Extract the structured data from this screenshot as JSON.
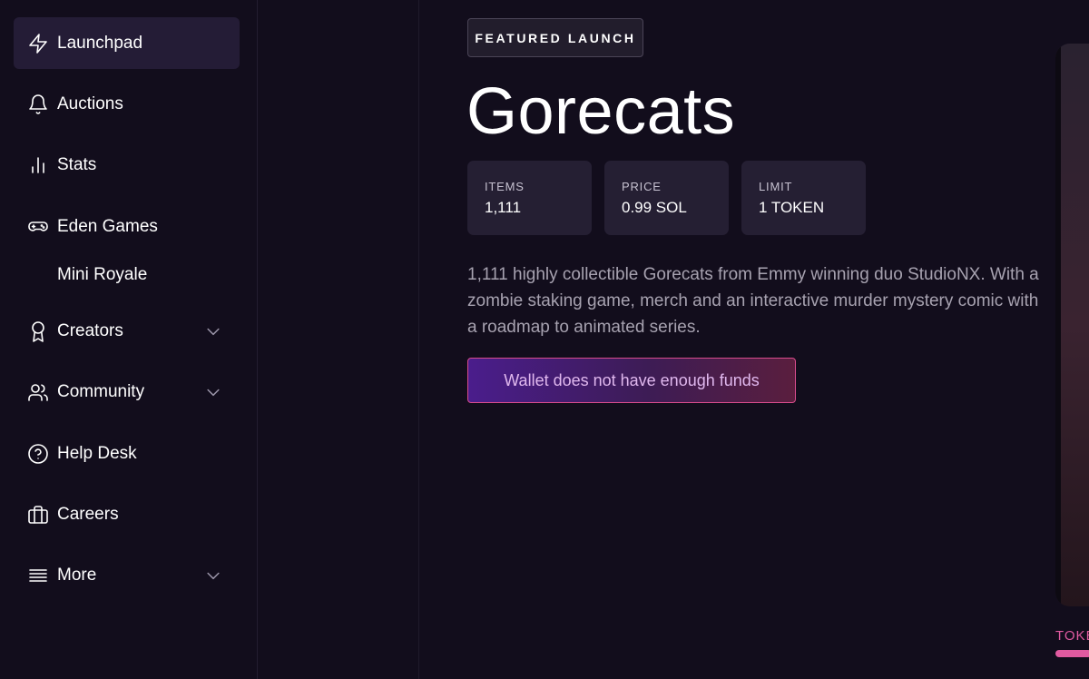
{
  "sidebar": {
    "items": [
      {
        "label": "Launchpad",
        "icon": "lightning-icon",
        "active": true
      },
      {
        "label": "Auctions",
        "icon": "bell-icon"
      },
      {
        "label": "Stats",
        "icon": "bar-chart-icon"
      },
      {
        "label": "Eden Games",
        "icon": "gamepad-icon"
      },
      {
        "label": "Creators",
        "icon": "award-icon",
        "expandable": true
      },
      {
        "label": "Community",
        "icon": "users-icon",
        "expandable": true
      },
      {
        "label": "Help Desk",
        "icon": "help-circle-icon"
      },
      {
        "label": "Careers",
        "icon": "briefcase-icon"
      },
      {
        "label": "More",
        "icon": "menu-lines-icon",
        "expandable": true
      }
    ],
    "subitems": [
      {
        "label": "Mini Royale"
      }
    ]
  },
  "main": {
    "badge": "FEATURED LAUNCH",
    "title": "Gorecats",
    "stats": [
      {
        "label": "ITEMS",
        "value": "1,111"
      },
      {
        "label": "PRICE",
        "value": "0.99 SOL"
      },
      {
        "label": "LIMIT",
        "value": "1 TOKEN"
      }
    ],
    "description": "1,111 highly collectible Gorecats from Emmy winning duo StudioNX. With a zombie staking game, merch and an interactive murder mystery comic with a roadmap to animated series.",
    "cta_label": "Wallet does not have enough funds",
    "tab_label_partial": "TOKE"
  },
  "colors": {
    "background": "#120d1c",
    "accent_pink": "#e05aa0",
    "accent_purple": "#4a1d8c"
  }
}
